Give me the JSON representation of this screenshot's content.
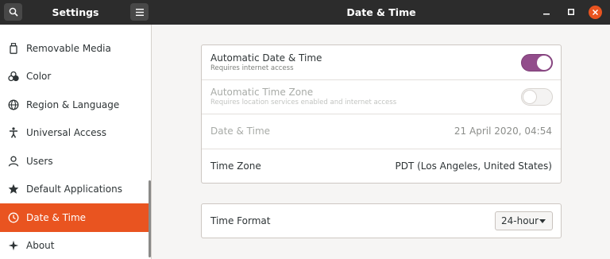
{
  "header": {
    "sidebar_title": "Settings",
    "main_title": "Date & Time",
    "icons": {
      "search": "search-icon",
      "menu": "hamburger-menu-icon",
      "minimize": "minimize-icon",
      "maximize": "maximize-icon",
      "close": "close-icon"
    },
    "close_color": "#e95420"
  },
  "sidebar": {
    "items": [
      {
        "label": "Removable Media",
        "icon": "usb-drive-icon",
        "active": false
      },
      {
        "label": "Color",
        "icon": "color-palette-icon",
        "active": false
      },
      {
        "label": "Region & Language",
        "icon": "globe-icon",
        "active": false
      },
      {
        "label": "Universal Access",
        "icon": "accessibility-icon",
        "active": false
      },
      {
        "label": "Users",
        "icon": "user-icon",
        "active": false
      },
      {
        "label": "Default Applications",
        "icon": "star-icon",
        "active": false
      },
      {
        "label": "Date & Time",
        "icon": "clock-icon",
        "active": true
      },
      {
        "label": "About",
        "icon": "sparkle-icon",
        "active": false
      }
    ],
    "active_color": "#e95420"
  },
  "main": {
    "automatic_date_time": {
      "title": "Automatic Date & Time",
      "subtitle": "Requires internet access",
      "enabled": true
    },
    "automatic_time_zone": {
      "title": "Automatic Time Zone",
      "subtitle": "Requires location services enabled and internet access",
      "enabled": false
    },
    "date_time": {
      "title": "Date & Time",
      "value": "21 April 2020, 04:54"
    },
    "time_zone": {
      "title": "Time Zone",
      "value": "PDT (Los Angeles, United States)"
    },
    "time_format": {
      "title": "Time Format",
      "value": "24-hour"
    },
    "toggle_on_color": "#924d8b"
  }
}
